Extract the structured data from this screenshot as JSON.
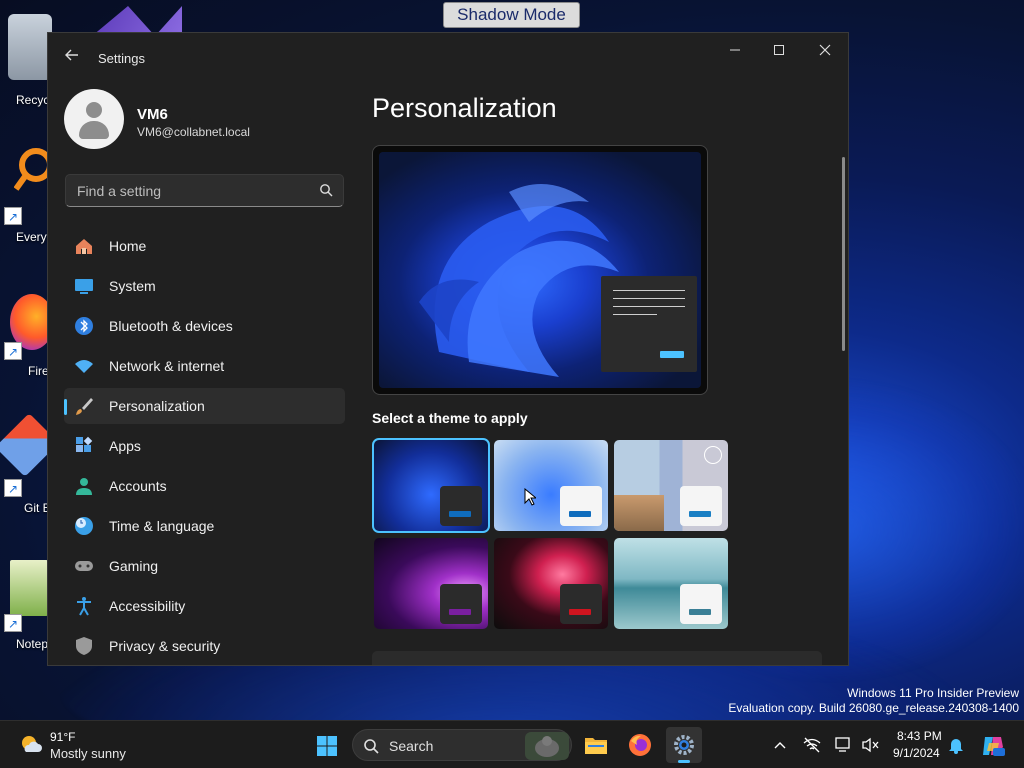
{
  "desktop": {
    "shadow_mode_label": "Shadow Mode",
    "icons": [
      {
        "label": "Recycl",
        "icon": "recycle-bin-icon"
      },
      {
        "label": "Everyt",
        "icon": "everything-search-icon"
      },
      {
        "label": "Fire",
        "icon": "firefox-icon"
      },
      {
        "label": "Git B",
        "icon": "git-bash-icon"
      },
      {
        "label": "Notep",
        "icon": "notepad-plus-plus-icon"
      }
    ],
    "watermark_line1": "Windows 11 Pro Insider Preview",
    "watermark_line2": "Evaluation copy. Build 26080.ge_release.240308-1400"
  },
  "window": {
    "title": "Settings",
    "back_icon": "back-arrow-icon",
    "controls": [
      "minimize",
      "maximize",
      "close"
    ]
  },
  "profile": {
    "name": "VM6",
    "email": "VM6@collabnet.local"
  },
  "search": {
    "placeholder": "Find a setting",
    "value": ""
  },
  "nav": {
    "items": [
      {
        "label": "Home",
        "icon": "home-icon",
        "color": "#e8835b"
      },
      {
        "label": "System",
        "icon": "system-monitor-icon",
        "color": "#3aa0e8"
      },
      {
        "label": "Bluetooth & devices",
        "icon": "bluetooth-icon",
        "color": "#2f7fe0"
      },
      {
        "label": "Network & internet",
        "icon": "wifi-icon",
        "color": "#4fb0f5"
      },
      {
        "label": "Personalization",
        "icon": "paintbrush-icon",
        "color": "#e09a4a"
      },
      {
        "label": "Apps",
        "icon": "apps-icon",
        "color": "#4a9ee8"
      },
      {
        "label": "Accounts",
        "icon": "person-icon",
        "color": "#34b89a"
      },
      {
        "label": "Time & language",
        "icon": "clock-globe-icon",
        "color": "#3aa0e8"
      },
      {
        "label": "Gaming",
        "icon": "controller-icon",
        "color": "#9a9a9a"
      },
      {
        "label": "Accessibility",
        "icon": "accessibility-icon",
        "color": "#3aa0e8"
      },
      {
        "label": "Privacy & security",
        "icon": "shield-icon",
        "color": "#9a9a9a"
      }
    ],
    "active_index": 4
  },
  "main": {
    "title": "Personalization",
    "theme_heading": "Select a theme to apply",
    "themes": [
      {
        "name": "windows-dark",
        "accent": "#0f6cbd",
        "selected": true
      },
      {
        "name": "windows-light",
        "accent": "#0f6cbd",
        "selected": false
      },
      {
        "name": "windows-spotlight",
        "accent": "#1a7fc4",
        "selected": false
      },
      {
        "name": "glow",
        "accent": "#7a1fa0",
        "selected": false
      },
      {
        "name": "captured-motion",
        "accent": "#d0141f",
        "selected": false
      },
      {
        "name": "flow",
        "accent": "#3a7f96",
        "selected": false
      }
    ],
    "accent_color": "#4cc2ff"
  },
  "taskbar": {
    "weather_temp": "91°F",
    "weather_desc": "Mostly sunny",
    "search_label": "Search",
    "pinned": [
      "start-icon",
      "file-explorer-icon",
      "firefox-icon",
      "settings-gear-icon"
    ],
    "tray": [
      "chevron-up-icon",
      "network-off-icon",
      "display-icon",
      "volume-muted-icon",
      "bell-icon",
      "copilot-icon"
    ],
    "time": "8:43 PM",
    "date": "9/1/2024"
  }
}
